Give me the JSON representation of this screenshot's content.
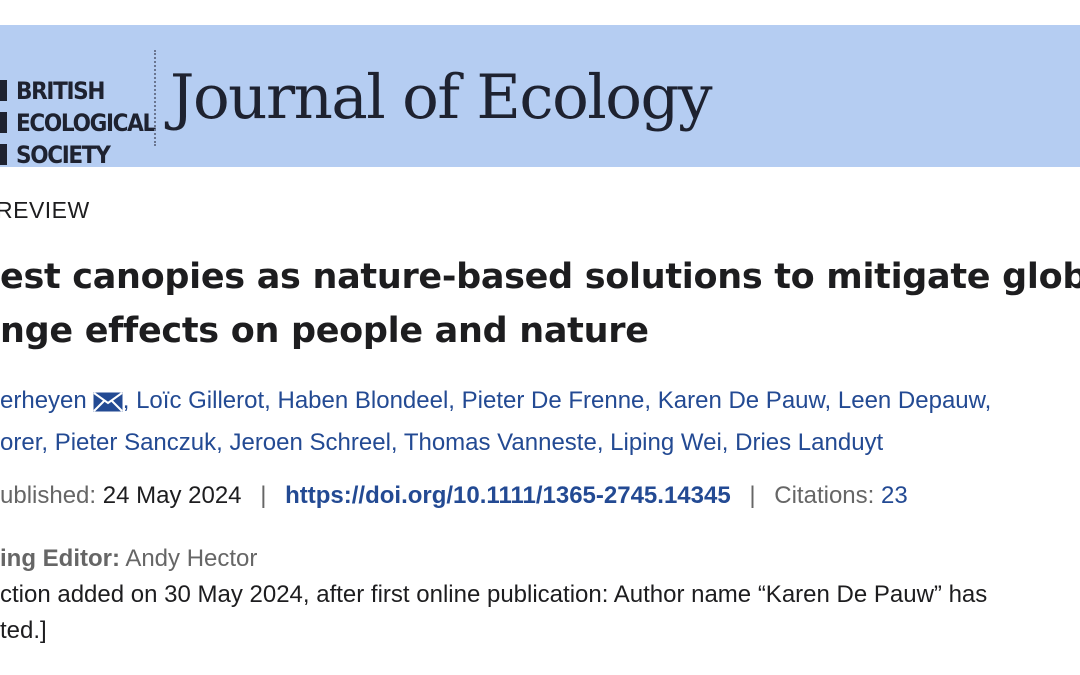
{
  "header": {
    "society_lines": [
      "BRITISH",
      "ECOLOGICAL",
      "SOCIETY"
    ],
    "journal_title": "Journal of Ecology",
    "colors": {
      "banner": "#b5cdf2",
      "ink": "#1e2230"
    }
  },
  "article": {
    "type": "REVIEW",
    "title_lines": [
      "est canopies as nature-based solutions to mitigate globa",
      "nge effects on people and nature"
    ],
    "authors_line1": [
      "erheyen",
      "Loïc Gillerot",
      "Haben Blondeel",
      "Pieter De Frenne",
      "Karen De Pauw",
      "Leen Depauw"
    ],
    "authors_line2": [
      "orer",
      "Pieter Sanczuk",
      "Jeroen Schreel",
      "Thomas Vanneste",
      "Liping Wei",
      "Dries Landuyt"
    ],
    "email_icon": "envelope-icon",
    "published_label": "ublished:",
    "published_date": "24 May 2024",
    "doi": "https://doi.org/10.1111/1365-2745.14345",
    "citations_label": "Citations:",
    "citations_count": "23",
    "editor_label": "ing Editor:",
    "editor_name": "Andy Hector",
    "correction_lines": [
      "ction added on 30 May 2024, after first online publication: Author name “Karen De Pauw” has",
      "ted.]"
    ],
    "link_color": "#234a93"
  }
}
